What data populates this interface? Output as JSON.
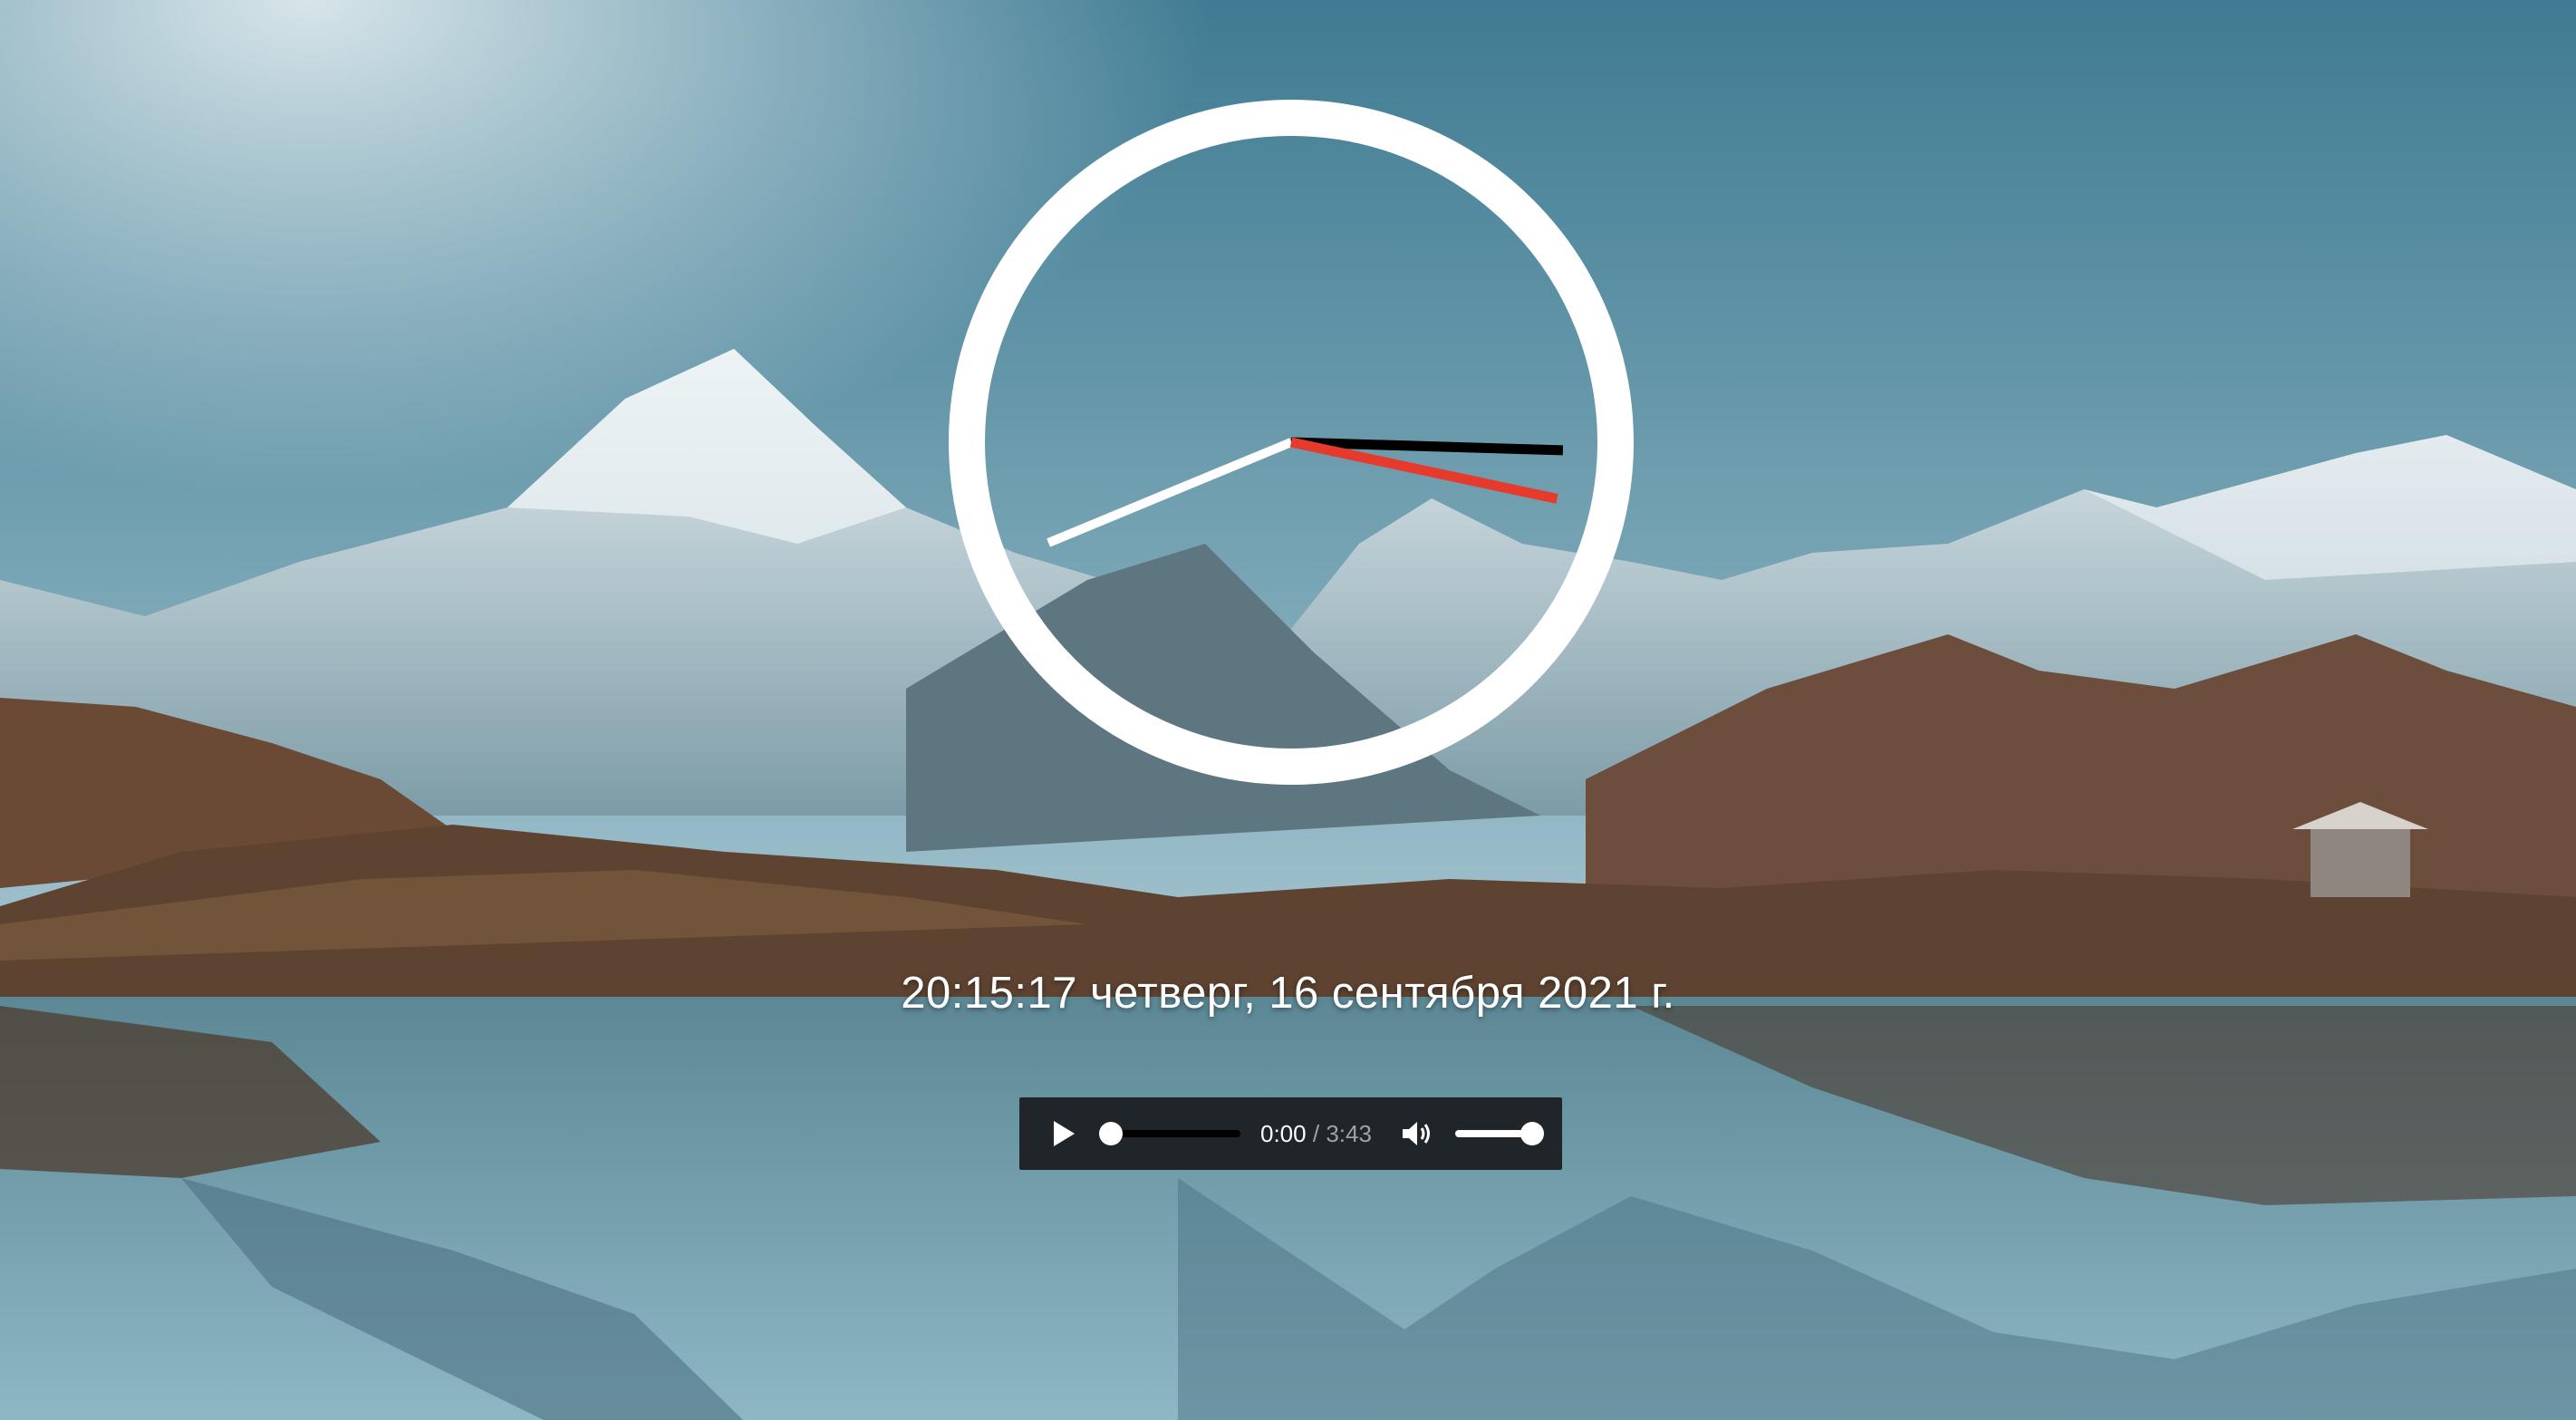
{
  "datetime_text": "20:15:17 четверг, 16 сентября 2021 г.",
  "clock": {
    "hour": 20,
    "minute": 15,
    "second": 17,
    "face_color": "#ffffff",
    "second_hand_color": "#e53a2c",
    "minute_hand_color": "#000000",
    "hour_hand_color": "#ffffff"
  },
  "player": {
    "current_time": "0:00",
    "separator": "/",
    "duration": "3:43",
    "progress": 0,
    "volume": 1,
    "play_icon": "play-icon",
    "volume_icon": "volume-icon"
  },
  "background": {
    "sky_top": "#3f7f97",
    "sky_mid": "#87b2c1",
    "lake": "#6e9fae"
  }
}
